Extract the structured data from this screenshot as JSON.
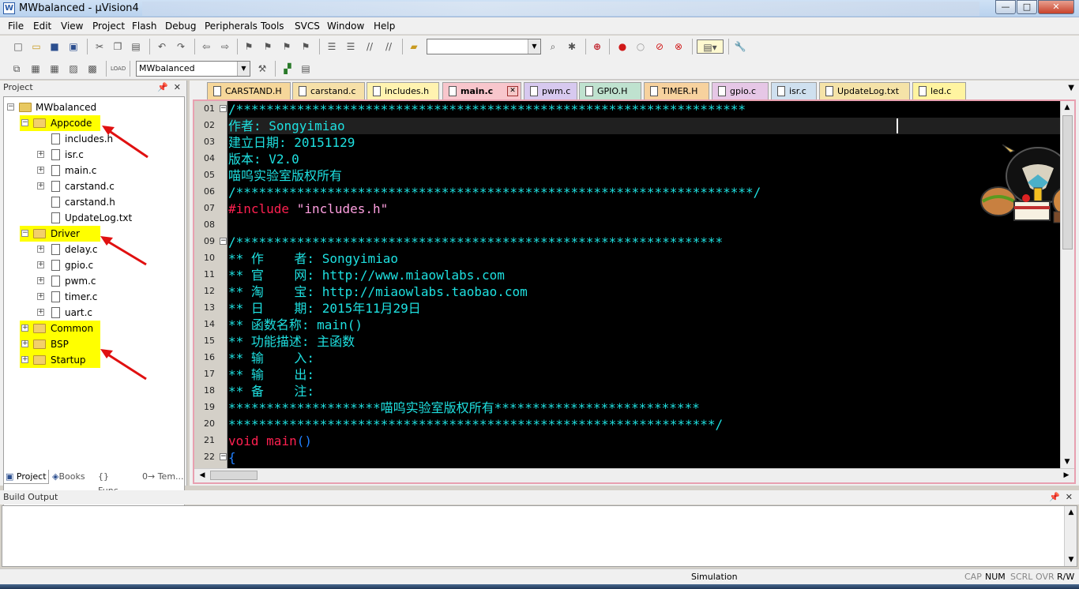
{
  "window": {
    "title": "MWbalanced - µVision4",
    "min": "—",
    "max": "□",
    "close": "✕"
  },
  "menu": [
    "File",
    "Edit",
    "View",
    "Project",
    "Flash",
    "Debug",
    "Peripherals",
    "Tools",
    "SVCS",
    "Window",
    "Help"
  ],
  "toolbar": {
    "find_combo_value": "",
    "target_combo_value": "MWbalanced"
  },
  "project_panel": {
    "title": "Project",
    "root": "MWbalanced",
    "groups": [
      {
        "name": "Appcode",
        "files": [
          "includes.h",
          "isr.c",
          "main.c",
          "carstand.c",
          "carstand.h",
          "UpdateLog.txt"
        ]
      },
      {
        "name": "Driver",
        "files": [
          "delay.c",
          "gpio.c",
          "pwm.c",
          "timer.c",
          "uart.c"
        ]
      },
      {
        "name": "Common",
        "files": []
      },
      {
        "name": "BSP",
        "files": []
      },
      {
        "name": "Startup",
        "files": []
      }
    ],
    "tabs": [
      "Project",
      "Books",
      "{} Func...",
      "0→ Tem..."
    ]
  },
  "editor": {
    "tabs": [
      {
        "label": "CARSTAND.H",
        "color": "#f6d79a"
      },
      {
        "label": "carstand.c",
        "color": "#f6e0a8"
      },
      {
        "label": "includes.h",
        "color": "#fff3b0"
      },
      {
        "label": "main.c",
        "color": "#f8c6cc",
        "active": true
      },
      {
        "label": "pwm.c",
        "color": "#d7c9ef"
      },
      {
        "label": "GPIO.H",
        "color": "#bfe2cf"
      },
      {
        "label": "TIMER.H",
        "color": "#f7d29e"
      },
      {
        "label": "gpio.c",
        "color": "#e6c7e6"
      },
      {
        "label": "isr.c",
        "color": "#cfe0ef"
      },
      {
        "label": "UpdateLog.txt",
        "color": "#f5e3a8"
      },
      {
        "label": "led.c",
        "color": "#fff4a0"
      }
    ],
    "line_numbers": [
      "01",
      "02",
      "03",
      "04",
      "05",
      "06",
      "07",
      "08",
      "09",
      "10",
      "11",
      "12",
      "13",
      "14",
      "15",
      "16",
      "17",
      "18",
      "19",
      "20",
      "21",
      "22"
    ],
    "lines": [
      "/*******************************************************************",
      "作者: Songyimiao",
      "建立日期: 20151129",
      "版本: V2.0",
      "喵呜实验室版权所有",
      "/********************************************************************/",
      "#include \"includes.h\"",
      "",
      "/****************************************************************",
      "** 作    者: Songyimiao",
      "** 官    网: http://www.miaowlabs.com",
      "** 淘    宝: http://miaowlabs.taobao.com",
      "** 日    期: 2015年11月29日",
      "** 函数名称: main()",
      "** 功能描述: 主函数",
      "** 输    入:",
      "** 输    出:",
      "** 备    注:",
      "********************喵呜实验室版权所有***************************",
      "****************************************************************/",
      "void main()",
      "{"
    ]
  },
  "build_output": {
    "title": "Build Output",
    "content": ""
  },
  "status": {
    "mode": "Simulation",
    "cap": "CAP",
    "num": "NUM",
    "scrl": "SCRL",
    "ovr": "OVR",
    "rw": "R/W"
  }
}
